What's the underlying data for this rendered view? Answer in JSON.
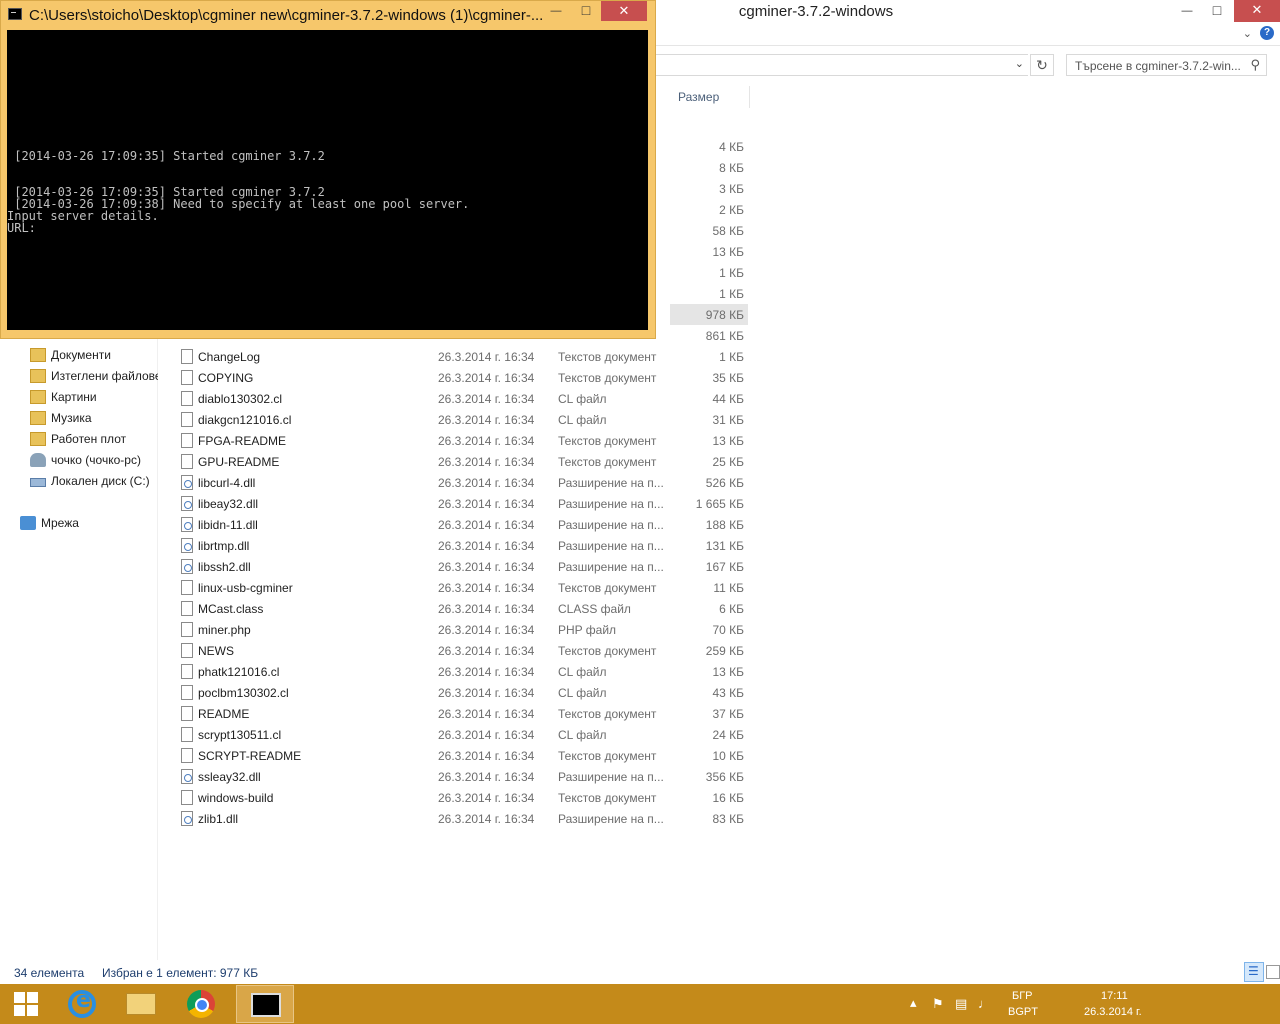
{
  "explorer": {
    "title": "cgminer-3.7.2-windows",
    "search_placeholder": "Търсене в cgminer-3.7.2-win...",
    "column_size": "Размер",
    "partial_sizes": [
      "4 КБ",
      "8 КБ",
      "3 КБ",
      "2 КБ",
      "58 КБ",
      "13 КБ",
      "1 КБ",
      "1 КБ",
      "978 КБ",
      "861 КБ"
    ],
    "nav_items": [
      {
        "label": "Документи",
        "icon": "folder-icon"
      },
      {
        "label": "Изтеглени файлове",
        "icon": "folder-icon"
      },
      {
        "label": "Картини",
        "icon": "folder-icon"
      },
      {
        "label": "Музика",
        "icon": "folder-icon"
      },
      {
        "label": "Работен плот",
        "icon": "folder-icon"
      },
      {
        "label": "чочко (чочко-pc)",
        "icon": "user-icon"
      },
      {
        "label": "Локален диск (C:)",
        "icon": "drive-icon"
      },
      {
        "label": "Мрежа",
        "icon": "network-icon"
      }
    ],
    "files": [
      {
        "name": "ChangeLog",
        "date": "26.3.2014 г. 16:34",
        "type": "Текстов документ",
        "size": "1 КБ"
      },
      {
        "name": "COPYING",
        "date": "26.3.2014 г. 16:34",
        "type": "Текстов документ",
        "size": "35 КБ"
      },
      {
        "name": "diablo130302.cl",
        "date": "26.3.2014 г. 16:34",
        "type": "CL файл",
        "size": "44 КБ"
      },
      {
        "name": "diakgcn121016.cl",
        "date": "26.3.2014 г. 16:34",
        "type": "CL файл",
        "size": "31 КБ"
      },
      {
        "name": "FPGA-README",
        "date": "26.3.2014 г. 16:34",
        "type": "Текстов документ",
        "size": "13 КБ"
      },
      {
        "name": "GPU-README",
        "date": "26.3.2014 г. 16:34",
        "type": "Текстов документ",
        "size": "25 КБ"
      },
      {
        "name": "libcurl-4.dll",
        "date": "26.3.2014 г. 16:34",
        "type": "Разширение на п...",
        "size": "526 КБ"
      },
      {
        "name": "libeay32.dll",
        "date": "26.3.2014 г. 16:34",
        "type": "Разширение на п...",
        "size": "1 665 КБ"
      },
      {
        "name": "libidn-11.dll",
        "date": "26.3.2014 г. 16:34",
        "type": "Разширение на п...",
        "size": "188 КБ"
      },
      {
        "name": "librtmp.dll",
        "date": "26.3.2014 г. 16:34",
        "type": "Разширение на п...",
        "size": "131 КБ"
      },
      {
        "name": "libssh2.dll",
        "date": "26.3.2014 г. 16:34",
        "type": "Разширение на п...",
        "size": "167 КБ"
      },
      {
        "name": "linux-usb-cgminer",
        "date": "26.3.2014 г. 16:34",
        "type": "Текстов документ",
        "size": "11 КБ"
      },
      {
        "name": "MCast.class",
        "date": "26.3.2014 г. 16:34",
        "type": "CLASS файл",
        "size": "6 КБ"
      },
      {
        "name": "miner.php",
        "date": "26.3.2014 г. 16:34",
        "type": "PHP файл",
        "size": "70 КБ"
      },
      {
        "name": "NEWS",
        "date": "26.3.2014 г. 16:34",
        "type": "Текстов документ",
        "size": "259 КБ"
      },
      {
        "name": "phatk121016.cl",
        "date": "26.3.2014 г. 16:34",
        "type": "CL файл",
        "size": "13 КБ"
      },
      {
        "name": "poclbm130302.cl",
        "date": "26.3.2014 г. 16:34",
        "type": "CL файл",
        "size": "43 КБ"
      },
      {
        "name": "README",
        "date": "26.3.2014 г. 16:34",
        "type": "Текстов документ",
        "size": "37 КБ"
      },
      {
        "name": "scrypt130511.cl",
        "date": "26.3.2014 г. 16:34",
        "type": "CL файл",
        "size": "24 КБ"
      },
      {
        "name": "SCRYPT-README",
        "date": "26.3.2014 г. 16:34",
        "type": "Текстов документ",
        "size": "10 КБ"
      },
      {
        "name": "ssleay32.dll",
        "date": "26.3.2014 г. 16:34",
        "type": "Разширение на п...",
        "size": "356 КБ"
      },
      {
        "name": "windows-build",
        "date": "26.3.2014 г. 16:34",
        "type": "Текстов документ",
        "size": "16 КБ"
      },
      {
        "name": "zlib1.dll",
        "date": "26.3.2014 г. 16:34",
        "type": "Разширение на п...",
        "size": "83 КБ"
      }
    ],
    "status_count": "34 елемента",
    "status_selected": "Избран е 1 елемент: 977 КБ"
  },
  "cmd": {
    "title": "C:\\Users\\stoicho\\Desktop\\cgminer new\\cgminer-3.7.2-windows (1)\\cgminer-...",
    "lines": [
      " [2014-03-26 17:09:35] Started cgminer 3.7.2",
      " [2014-03-26 17:09:35] Started cgminer 3.7.2",
      " [2014-03-26 17:09:38] Need to specify at least one pool server.",
      "Input server details.",
      "URL:"
    ]
  },
  "taskbar": {
    "lang_1": "БГР",
    "lang_2": "BGPT",
    "time": "17:11",
    "date": "26.3.2014 г."
  },
  "colors": {
    "taskbar": "#c48a1a",
    "cmd_frame": "#f6c76b",
    "close_button": "#c74f4f"
  }
}
